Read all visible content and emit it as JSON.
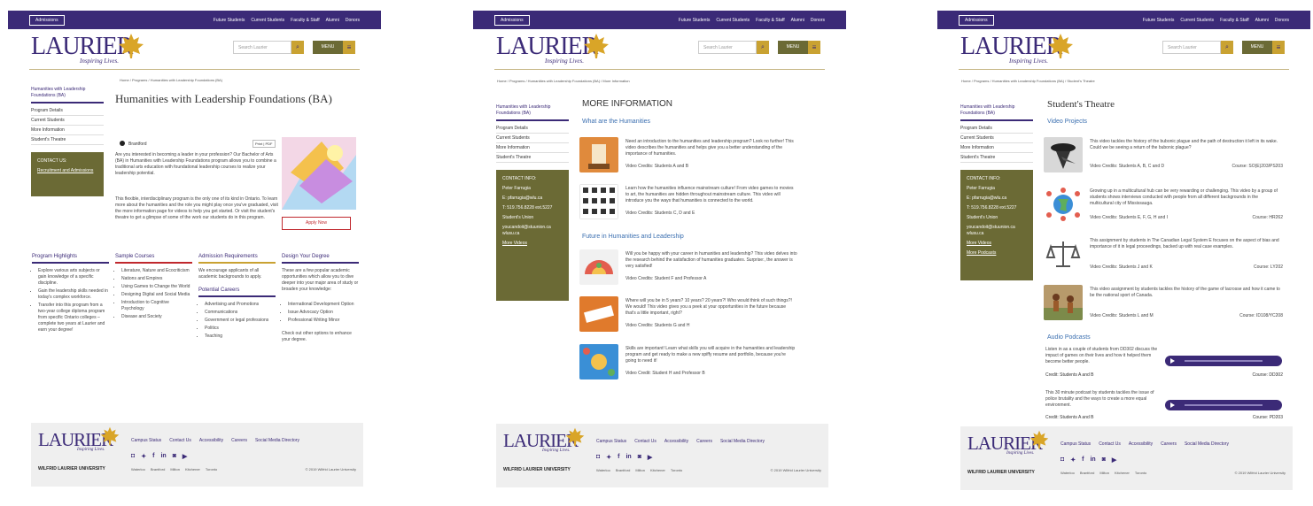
{
  "common": {
    "admissions": "Admissions",
    "top_links": [
      "Future Students",
      "Current Students",
      "Faculty & Staff",
      "Alumni",
      "Donors"
    ],
    "logo_word": "LAURIER",
    "logo_tag": "Inspiring Lives.",
    "search_placeholder": "Search Laurier",
    "menu_label": "MENU",
    "footer_links": [
      "Campus Status",
      "Contact Us",
      "Accessibility",
      "Careers",
      "Social Media Directory"
    ],
    "social_icons": [
      "instagram-icon",
      "twitter-icon",
      "facebook-icon",
      "linkedin-icon",
      "flickr-icon",
      "youtube-icon"
    ],
    "social_glyphs": [
      "◘",
      "✦",
      "f",
      "in",
      "◙",
      "▶"
    ],
    "university": "WILFRID LAURIER UNIVERSITY",
    "campuses": [
      "Waterloo",
      "Brantford",
      "Milton",
      "Kitchener",
      "Toronto"
    ],
    "copyright": "© 2019 Wilfrid Laurier University",
    "brand_purple": "#3b2a77",
    "brand_gold": "#c9a232",
    "brand_olive": "#6b6a35"
  },
  "page1": {
    "breadcrumb": "Home / Programs / Humanities with Leadership Foundations (BA)",
    "title": "Humanities with Leadership Foundations (BA)",
    "side_current": "Humanities with Leadership Foundations (BA)",
    "side_items": [
      "Program Details",
      "Current Students",
      "More Information",
      "Student's Theatre"
    ],
    "contact_title": "CONTACT US:",
    "contact_link": "Recruitment and Admissions",
    "campus_label": "Brantford",
    "print_label": "Print | PDF",
    "intro_p1": "Are you interested in becoming a leader in your profession? Our Bachelor of Arts (BA) in Humanities with Leadership Foundations program allows you to combine a traditional arts education with foundational leadership courses to realize your leadership potential.",
    "intro_p2": "This flexible, interdisciplinary program is the only one of its kind in Ontario. To learn more about the humanities and the role you might play once you've graduated, visit the more information page for videos to help you get started. Or visit the student's theatre to get a glimpse of some of the work our students do in this program.",
    "apply": "Apply Now",
    "columns": [
      {
        "title": "Program Highlights",
        "color": "#3b2a77",
        "items": [
          "Explore various arts subjects or gain knowledge of a specific discipline.",
          "Gain the leadership skills needed in today's complex workforce.",
          "Transfer into this program from a two-year college diploma program from specific Ontario colleges – complete two years at Laurier and earn your degree!"
        ]
      },
      {
        "title": "Sample Courses",
        "color": "#c0282d",
        "items": [
          "Literature, Nature and Ecocriticism",
          "Nations and Empires",
          "Using Games to Change the World",
          "Designing Digital and Social Media",
          "Introduction to Cognitive Psychology",
          "Disease and Society"
        ]
      },
      {
        "title": "Admission Requirements",
        "color": "#c9a232",
        "text": "We encourage applicants of all academic backgrounds to apply.",
        "sub_title": "Potential Careers",
        "items": [
          "Advertising and Promotions",
          "Communications",
          "Government or legal professions",
          "Politics",
          "Teaching"
        ]
      },
      {
        "title": "Design Your Degree",
        "color": "#3b2a77",
        "text": "These are a few popular academic opportunities which allow you to dive deeper into your major area of study or broaden your knowledge:",
        "items": [
          "International Development Option",
          "Issue Advocacy Option",
          "Professional Writing Minor"
        ],
        "text2": "Check out other options to enhance your degree."
      }
    ]
  },
  "page2": {
    "breadcrumb": "Home / Programs / Humanities with Leadership Foundations (BA) / More Information",
    "title": "MORE INFORMATION",
    "side_current": "Humanities with Leadership Foundations (BA)",
    "side_items": [
      "Program Details",
      "Current Students",
      "More Information",
      "Student's Theatre"
    ],
    "contact_lines": [
      "CONTACT INFO:",
      "Peter Farrugia",
      "E: pfarrugia@wlu.ca",
      "T: 519.756.8228 ext.5227",
      "Student's Union",
      "youcandoit@stuunion.ca",
      "wlusu.ca",
      "More Videos"
    ],
    "section1": "What are the Humanities",
    "section2": "Future in Humanities and Leadership",
    "videos": [
      {
        "text": "Need an introduction to the humanities and leadership program? Look no further! This video describes the humanities and helps give you a better understanding of the importance of humanities.",
        "credit": "Video Credits: Students A and B"
      },
      {
        "text": "Learn how the humanities influence mainstream culture! From video games to movies to art, the humanities are hidden throughout mainstream culture. This video will introduce you the ways that humanities is connected to the world.",
        "credit": "Video Credits: Students C, D and E"
      },
      {
        "text": "Will you be happy with your career in humanities and leadership? This video delves into the research behind the satisfaction of humanities graduates. Surprise:, the answer is very satisfied!",
        "credit": "Video Credits: Student F and Professor A"
      },
      {
        "text": "Where will you be in 5 years? 10 years? 20 years?! Who would think of such things?! We would! This video gives you a peek at your opportunities in the future because that's a little important, right?",
        "credit": "Video Credits: Students G and H"
      },
      {
        "text": "Skills are important! Learn what skills you will acquire in the humanities and leadership program and get ready to make a new spiffy resume and portfolio, because you're going to need it!",
        "credit": "Video Credit: Student H and Professor B"
      }
    ]
  },
  "page3": {
    "breadcrumb": "Home / Programs / Humanities with Leadership Foundations (BA) / Student's Theatre",
    "title": "Student's Theatre",
    "side_current": "Humanities with Leadership Foundations (BA)",
    "side_items": [
      "Program Details",
      "Current Students",
      "More Information",
      "Student's Theatre"
    ],
    "contact_lines": [
      "CONTACT INFO:",
      "Peter Farrugia",
      "E: pfarrugia@wlu.ca",
      "T: 519.756.8228 ext.5227",
      "Student's Union",
      "youcandoit@stuunion.ca",
      "wlusu.ca",
      "More Videos",
      "More Podcasts"
    ],
    "video_title": "Video Projects",
    "videos": [
      {
        "text": "This video tackles the history of the bubonic plague and the path of destruction it left in its wake. Could we be seeing a return of the bubonic plague?",
        "credit": "Video Credits: Students A, B, C and D",
        "course": "Course: SO(E)203/PS203"
      },
      {
        "text": "Growing up in a multicultural hub can be very rewarding or challenging. This video by a group of students shows interviews conducted with people from all different backgrounds in the multicultural city of Mississauga.",
        "credit": "Video Credits: Students E, F, G, H and I",
        "course": "Course: HR262"
      },
      {
        "text": "This assignment by students in The Canadian Legal System E focuses on the aspect of bias and importance of it in legal proceedings, backed up with real case examples.",
        "credit": "Video Credits: Students J and K",
        "course": "Course: LY202"
      },
      {
        "text": "This video assignment by students tackles the history of the game of lacrosse and how it came to be the national sport of Canada.",
        "credit": "Video Credits: Students L and M",
        "course": "Course: ID108/YC208"
      }
    ],
    "audio_title": "Audio Podcasts",
    "podcasts": [
      {
        "text": "Listen in as a couple of students from DD302 discuss the impact of games on their lives and how it helped them become better people.",
        "credit": "Credit: Students A and B",
        "course": "Course: DD302"
      },
      {
        "text": "This 30 minute podcast by students tackles the issue of police brutality and the ways to create a more equal environment.",
        "credit": "Credit: Students A and B",
        "course": "Course: PD203"
      }
    ]
  }
}
